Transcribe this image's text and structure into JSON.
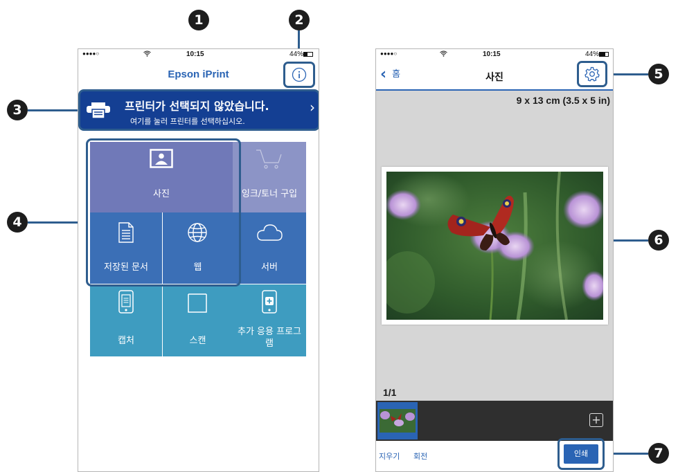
{
  "callouts": [
    "1",
    "2",
    "3",
    "4",
    "5",
    "6",
    "7"
  ],
  "left_phone": {
    "status": {
      "signal": "●●●●○",
      "time": "10:15",
      "battery": "44%"
    },
    "title": "Epson iPrint",
    "info_icon": "info-icon",
    "banner": {
      "main": "프린터가 선택되지 않았습니다.",
      "sub": "여기를 눌러 프린터를 선택하십시오.",
      "arrow": "›"
    },
    "tiles": [
      {
        "label": "사진",
        "icon": "photo-icon"
      },
      {
        "label": "잉크/토너 구입",
        "icon": "cart-icon"
      },
      {
        "label": "저장된 문서",
        "icon": "document-icon"
      },
      {
        "label": "웹",
        "icon": "globe-icon"
      },
      {
        "label": "서버",
        "icon": "cloud-icon"
      },
      {
        "label": "캡처",
        "icon": "capture-icon"
      },
      {
        "label": "스캔",
        "icon": "scan-icon"
      },
      {
        "label": "추가 응용 프로그램",
        "icon": "add-app-icon"
      }
    ],
    "colors": {
      "photo_tile": "#7079b8",
      "grey_tile": "#8c94c6",
      "blue_tile": "#3b6fb6",
      "teal_tile": "#3e9cc0",
      "banner": "#143f93"
    }
  },
  "right_phone": {
    "status": {
      "signal": "●●●●○",
      "time": "10:15",
      "battery": "44%"
    },
    "back_label": "홈",
    "title": "사진",
    "paper_size": "9 x 13 cm (3.5 x 5 in)",
    "page_count": "1/1",
    "bottom": {
      "delete": "지우기",
      "rotate": "회전",
      "print": "인쇄"
    },
    "add_symbol": "+",
    "colors": {
      "accent": "#2a64b4",
      "canvas": "#d6d6d6",
      "strip": "#2f2f2f"
    }
  }
}
